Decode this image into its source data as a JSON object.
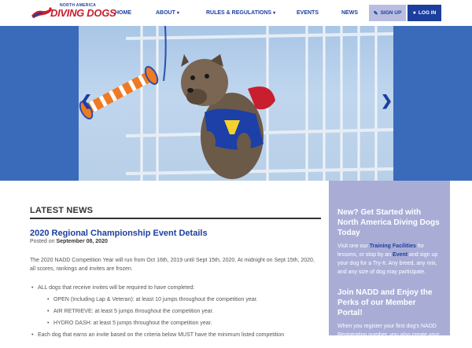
{
  "header": {
    "logo": {
      "line1": "NORTH AMERICA",
      "line2": "DIVING DOGS"
    },
    "nav": [
      {
        "label": "HOME",
        "dropdown": false
      },
      {
        "label": "ABOUT",
        "dropdown": true
      },
      {
        "label": "RULES & REGULATIONS",
        "dropdown": true
      },
      {
        "label": "EVENTS",
        "dropdown": false
      },
      {
        "label": "NEWS",
        "dropdown": false
      }
    ],
    "signup_label": "SIGN UP",
    "login_label": "LOG IN"
  },
  "colors": {
    "brand_blue": "#1c3f9e",
    "brand_red": "#c81e2e",
    "sidebar_bg": "#a9add6",
    "signup_bg": "#b9bee0"
  },
  "hero": {
    "prev_icon": "chevron-left-icon",
    "next_icon": "chevron-right-icon"
  },
  "news": {
    "heading": "LATEST NEWS",
    "post": {
      "title": "2020 Regional Championship Event Details",
      "posted_prefix": "Posted on",
      "date": "September 08, 2020",
      "para1": "The 2020 NADD Competition Year will run from Oct 16th, 2019 until Sept 15th, 2020. At midnight on Sept 15th, 2020, all scores, rankings and invites are frozen.",
      "bullet1": "ALL dogs that receive invites will be required to have completed:",
      "sub": [
        "OPEN (Including Lap & Veteran): at least 10 jumps throughout the competition year.",
        "AIR RETRIEVE: at least 5 jumps throughout the competition year.",
        "HYDRO DASH: at least 5 jumps throughout the competition year."
      ],
      "bullet2": "Each dog that earns an invite based on the criteria below MUST have the minimum listed competition"
    }
  },
  "sidebar": {
    "heading1": "New? Get Started with North America Diving Dogs Today",
    "p1_a": "Visit one our ",
    "p1_link1": "Training Facilities",
    "p1_b": " for lessons, or stop by an ",
    "p1_link2": "Event",
    "p1_c": " and sign up your dog for a Try-It. Any breed, any mix, and any size of dog may participate.",
    "heading2": "Join NADD and Enjoy the Perks of our Member Portal!",
    "p2": "When you register your first dog's NADD Registration number, you also create your own account on"
  }
}
